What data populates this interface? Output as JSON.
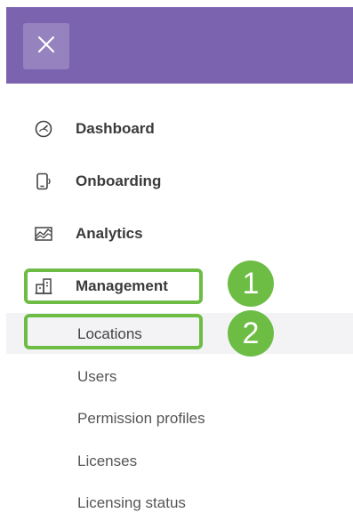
{
  "header": {
    "close_icon": "close-icon",
    "background_color": "#7b63b0"
  },
  "nav": {
    "items": [
      {
        "label": "Dashboard",
        "icon": "speedometer-icon"
      },
      {
        "label": "Onboarding",
        "icon": "device-signal-icon"
      },
      {
        "label": "Analytics",
        "icon": "chart-area-icon"
      },
      {
        "label": "Management",
        "icon": "building-icon"
      }
    ],
    "management_subitems": [
      {
        "label": "Locations",
        "active": true
      },
      {
        "label": "Users"
      },
      {
        "label": "Permission profiles"
      },
      {
        "label": "Licenses"
      },
      {
        "label": "Licensing status"
      }
    ]
  },
  "annotations": {
    "step1": "1",
    "step2": "2",
    "color": "#6dbd45"
  }
}
